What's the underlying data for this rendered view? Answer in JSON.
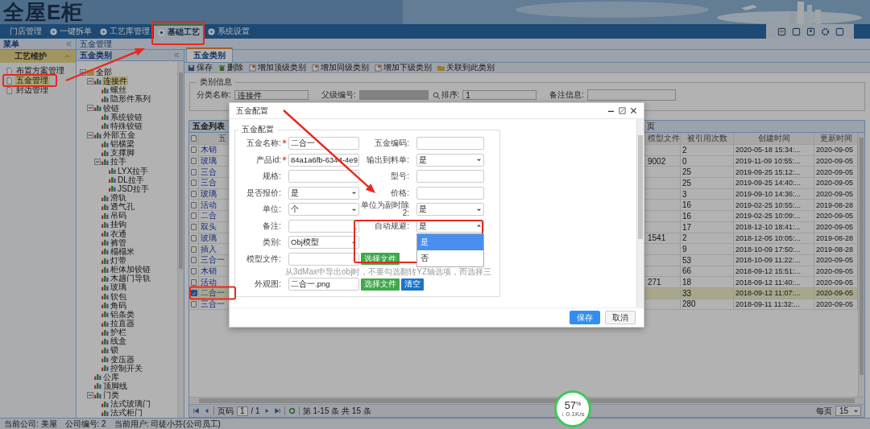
{
  "banner": {
    "logo": "全屋E柜"
  },
  "nav": {
    "tabs": [
      {
        "label": "门店管理",
        "selected": false
      },
      {
        "label": "一键拆单",
        "selected": false
      },
      {
        "label": "工艺库管理",
        "selected": false
      },
      {
        "label": "基础工艺",
        "selected": true
      },
      {
        "label": "系统设置",
        "selected": false
      }
    ]
  },
  "sidebar": {
    "title": "菜单",
    "section": "工艺维护",
    "items": [
      {
        "label": "布置方案管理",
        "selected": false
      },
      {
        "label": "五金管理",
        "selected": true
      },
      {
        "label": "封边管理",
        "selected": false
      }
    ]
  },
  "breadcrumb": "五金管理",
  "tree": {
    "title": "五金类别",
    "nodes": [
      {
        "label": "全部",
        "selected": false,
        "expanded": true,
        "children": [
          {
            "label": "连接件",
            "selected": true,
            "expanded": true,
            "children": [
              {
                "label": "螺丝",
                "selected": false
              },
              {
                "label": "隐形件系列",
                "selected": false
              }
            ]
          },
          {
            "label": "铰链",
            "selected": false,
            "expanded": true,
            "children": [
              {
                "label": "系统铰链",
                "selected": false
              },
              {
                "label": "特殊铰链",
                "selected": false
              }
            ]
          },
          {
            "label": "外部五金",
            "selected": false,
            "expanded": true,
            "children": [
              {
                "label": "铝横梁",
                "selected": false
              },
              {
                "label": "支撑脚",
                "selected": false
              },
              {
                "label": "拉手",
                "selected": false,
                "expanded": true,
                "children": [
                  {
                    "label": "LYX拉手",
                    "selected": false
                  },
                  {
                    "label": "DL拉手",
                    "selected": false
                  },
                  {
                    "label": "JSD拉手",
                    "selected": false
                  }
                ]
              },
              {
                "label": "滑轨",
                "selected": false
              },
              {
                "label": "透气孔",
                "selected": false
              },
              {
                "label": "吊码",
                "selected": false
              },
              {
                "label": "挂钩",
                "selected": false
              },
              {
                "label": "衣通",
                "selected": false
              },
              {
                "label": "裤管",
                "selected": false
              },
              {
                "label": "榻榻米",
                "selected": false
              },
              {
                "label": "灯带",
                "selected": false
              },
              {
                "label": "柜体加铰链",
                "selected": false
              },
              {
                "label": "木趟门导轨",
                "selected": false
              },
              {
                "label": "玻璃",
                "selected": false
              },
              {
                "label": "软包",
                "selected": false
              },
              {
                "label": "角码",
                "selected": false
              },
              {
                "label": "铝条类",
                "selected": false
              },
              {
                "label": "拉直器",
                "selected": false
              },
              {
                "label": "护栏",
                "selected": false
              },
              {
                "label": "线盒",
                "selected": false
              },
              {
                "label": "锁",
                "selected": false
              },
              {
                "label": "变压器",
                "selected": false
              },
              {
                "label": "控制开关",
                "selected": false
              }
            ]
          },
          {
            "label": "公库",
            "selected": false
          },
          {
            "label": "顶脚线",
            "selected": false
          },
          {
            "label": "门类",
            "selected": false,
            "expanded": true,
            "children": [
              {
                "label": "法式玻璃门",
                "selected": false
              },
              {
                "label": "法式柜门",
                "selected": false
              }
            ]
          }
        ]
      }
    ]
  },
  "main_tabs": [
    {
      "label": "五金类别",
      "selected": true
    }
  ],
  "toolbar": [
    {
      "label": "保存",
      "kind": "save"
    },
    {
      "label": "删除",
      "kind": "delete"
    },
    {
      "label": "增加顶级类别",
      "kind": "add"
    },
    {
      "label": "增加同级类别",
      "kind": "add"
    },
    {
      "label": "增加下级类别",
      "kind": "add"
    },
    {
      "label": "关联到此类别",
      "kind": "link"
    }
  ],
  "category_info": {
    "legend": "类别信息",
    "fields": [
      {
        "label": "分类名称:",
        "kind": "text",
        "value": "连接件"
      },
      {
        "label": "父级编号:",
        "kind": "lookup"
      },
      {
        "label": "排序:",
        "kind": "text",
        "value": "1"
      },
      {
        "label": "备注信息:",
        "kind": "textarea"
      }
    ]
  },
  "grid": {
    "title": "五金列表",
    "title_tail": "页",
    "all_selected": false,
    "columns": [
      "五",
      "模型文件",
      "被引用次数",
      "创建时间",
      "更新时间"
    ],
    "rows": [
      {
        "selected": false,
        "cells": [
          "木销",
          "",
          "2",
          "2020-05-18 15:34:...",
          "2020-09-05"
        ]
      },
      {
        "selected": false,
        "cells": [
          "玻璃",
          "9002",
          "0",
          "2019-11-09 10:55:...",
          "2020-09-05"
        ]
      },
      {
        "selected": false,
        "cells": [
          "三合",
          "",
          "25",
          "2019-09-25 15:12:...",
          "2020-09-05"
        ]
      },
      {
        "selected": false,
        "cells": [
          "三合",
          "",
          "25",
          "2019-09-25 14:40:...",
          "2020-09-05"
        ]
      },
      {
        "selected": false,
        "cells": [
          "玻璃",
          "",
          "3",
          "2019-09-10 14:36:...",
          "2020-09-05"
        ]
      },
      {
        "selected": false,
        "cells": [
          "活动",
          "",
          "16",
          "2019-02-25 10:55:...",
          "2019-08-28"
        ]
      },
      {
        "selected": false,
        "cells": [
          "二合",
          "",
          "16",
          "2019-02-25 10:09:...",
          "2020-09-05"
        ]
      },
      {
        "selected": false,
        "cells": [
          "双头",
          "",
          "17",
          "2018-12-10 18:41:...",
          "2020-09-05"
        ]
      },
      {
        "selected": false,
        "cells": [
          "玻璃",
          "1541",
          "2",
          "2018-12-05 10:05:...",
          "2019-08-28"
        ]
      },
      {
        "selected": false,
        "cells": [
          "插入",
          "",
          "9",
          "2018-10-09 17:50:...",
          "2019-08-28"
        ]
      },
      {
        "selected": false,
        "cells": [
          "三合一",
          "",
          "53",
          "2018-10-09 11:22:...",
          "2020-09-05"
        ]
      },
      {
        "selected": false,
        "cells": [
          "木销",
          "",
          "66",
          "2018-09-12 15:51:...",
          "2020-09-05"
        ]
      },
      {
        "selected": false,
        "cells": [
          "活动",
          "271",
          "18",
          "2018-09-12 11:40:...",
          "2020-09-05"
        ]
      },
      {
        "selected": true,
        "cells": [
          "二合一",
          "",
          "33",
          "2018-09-12 11:07:...",
          "2020-09-05"
        ]
      },
      {
        "selected": false,
        "cells": [
          "三合一",
          "",
          "280",
          "2018-09-11 11:32:...",
          "2020-09-05"
        ]
      }
    ]
  },
  "pager": {
    "page_label": "页码",
    "page": "1",
    "of": "/ 1",
    "info": "第 1-15 条  共 15 条",
    "per_page_label": "每页",
    "per_page": "15"
  },
  "status_bar": [
    "当前公司: 美屋",
    "公司编号: 2",
    "当前用户: 司徒小芬(公司员工)"
  ],
  "dialog": {
    "title": "五金配置",
    "legend": "五金配置",
    "rows": [
      {
        "left": {
          "kind": "text",
          "label": "五金名称:",
          "required": true,
          "value": "二合一"
        },
        "right": {
          "kind": "text",
          "label": "五金编码:",
          "required": false
        }
      },
      {
        "left": {
          "kind": "text",
          "label": "产品id:",
          "required": true,
          "value": "84a1a6fb-6344-4e9"
        },
        "right": {
          "kind": "select",
          "label": "输出到料单:",
          "required": false,
          "value": "是"
        }
      },
      {
        "left": {
          "kind": "text",
          "label": "规格:",
          "required": false
        },
        "right": {
          "kind": "text",
          "label": "型号:",
          "required": false
        }
      },
      {
        "left": {
          "kind": "select",
          "label": "是否报价:",
          "required": false,
          "value": "是"
        },
        "right": {
          "kind": "text",
          "label": "价格:",
          "required": false
        }
      },
      {
        "left": {
          "kind": "select",
          "label": "单位:",
          "required": false,
          "value": "个"
        },
        "right": {
          "kind": "select",
          "label": "单位为副时除2:",
          "required": false,
          "value": "是"
        }
      },
      {
        "left": {
          "kind": "textarea",
          "label": "备注:",
          "required": false
        },
        "right": {
          "kind": "select",
          "label": "自动规避:",
          "required": false,
          "value": "是",
          "options": [
            {
              "label": "是",
              "selected": true
            },
            {
              "label": "否",
              "selected": false
            }
          ]
        }
      },
      {
        "left": {
          "kind": "select",
          "label": "类别:",
          "required": false,
          "value": "Obj模型"
        }
      },
      {
        "left": {
          "kind": "file",
          "label": "模型文件:",
          "required": false,
          "buttons": [
            {
              "label": "选择文件",
              "kind": "success"
            }
          ]
        }
      },
      {
        "hint": "从3dMax中导出obj时，不要勾选翻转YZ轴选项，而选择三"
      },
      {
        "left": {
          "kind": "file",
          "label": "外观图:",
          "required": false,
          "value": "二合一.png",
          "buttons": [
            {
              "label": "选择文件",
              "kind": "success"
            },
            {
              "label": "清空",
              "kind": "primary"
            }
          ]
        }
      }
    ],
    "buttons": [
      {
        "label": "保存",
        "kind": "primary"
      },
      {
        "label": "取消",
        "kind": "default"
      }
    ]
  },
  "speed_widget": {
    "value": "57",
    "unit": "%",
    "speed": "↓ 0.1K/s"
  }
}
